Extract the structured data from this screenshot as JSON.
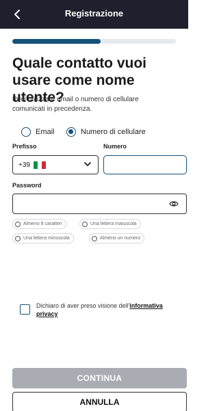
{
  "header": {
    "title": "Registrazione",
    "back_icon": "chevron-left-icon"
  },
  "progress": {
    "fraction": 0.54,
    "color": "#14527a"
  },
  "heading": "Quale contatto vuoi usare come nome utente?",
  "subtitle": "Puoi utilizzare email o numero di cellulare comunicati in precedenza.",
  "contact_options": [
    {
      "label": "Email",
      "checked": false
    },
    {
      "label": "Numero di cellulare",
      "checked": true
    }
  ],
  "prefix": {
    "label": "Prefisso",
    "value": "+39"
  },
  "number": {
    "label": "Numero",
    "value": ""
  },
  "password": {
    "label": "Password",
    "value": "",
    "icon": "eye-icon"
  },
  "requirements": [
    "Almeno 8 caratteri",
    "Una lettera maiuscola",
    "Una lettera minuscola",
    "Almeno un numero"
  ],
  "privacy": {
    "text": "Dichiaro di aver preso visione dell'",
    "link": "informativa privacy",
    "checked": false
  },
  "buttons": {
    "continue": "CONTINUA",
    "cancel": "ANNULLA"
  },
  "colors": {
    "header_bg": "#1f1f2d",
    "accent": "#14527a",
    "disabled": "#a9adb3"
  }
}
